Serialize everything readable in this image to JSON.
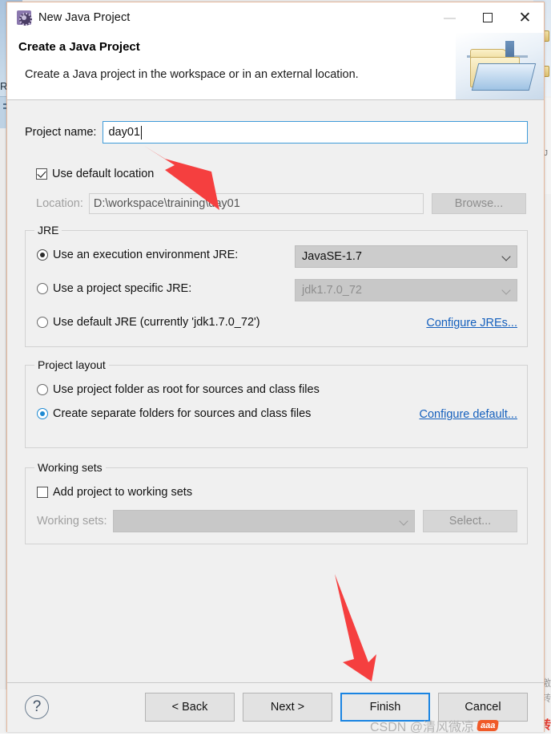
{
  "window": {
    "title": "New Java Project",
    "icon": "java-project-icon",
    "controls": {
      "minimize": "—",
      "maximize": "maximize-icon",
      "close": "×"
    }
  },
  "header": {
    "title": "Create a Java Project",
    "description": "Create a Java project in the workspace or in an external location.",
    "banner_icon": "java-project-folder-icon"
  },
  "form": {
    "project_name_label": "Project name:",
    "project_name_value": "day01",
    "use_default_location_label": "Use default location",
    "use_default_location_checked": true,
    "location_label": "Location:",
    "location_value": "D:\\workspace\\training\\day01",
    "browse_label": "Browse..."
  },
  "jre": {
    "group_title": "JRE",
    "option_execution_env": "Use an execution environment JRE:",
    "execution_env_value": "JavaSE-1.7",
    "option_project_specific": "Use a project specific JRE:",
    "project_specific_value": "jdk1.7.0_72",
    "option_default_jre": "Use default JRE (currently 'jdk1.7.0_72')",
    "configure_link": "Configure JREs...",
    "selected": "execution_env"
  },
  "project_layout": {
    "group_title": "Project layout",
    "option_project_folder": "Use project folder as root for sources and class files",
    "option_separate_folders": "Create separate folders for sources and class files",
    "configure_link": "Configure default...",
    "selected": "separate_folders"
  },
  "working_sets": {
    "group_title": "Working sets",
    "add_checkbox_label": "Add project to working sets",
    "add_checkbox_checked": false,
    "working_sets_label": "Working sets:",
    "working_sets_value": "",
    "select_label": "Select..."
  },
  "footer": {
    "help_label": "?",
    "back_label": "< Back",
    "next_label": "Next >",
    "finish_label": "Finish",
    "cancel_label": "Cancel",
    "default_button": "Finish"
  },
  "annotations": {
    "arrow_1_target": "project-name-input",
    "arrow_2_target": "finish-button",
    "arrow_color": "#f53f3f"
  },
  "watermark": {
    "text": "CSDN @清风微凉",
    "badge": "aaa"
  },
  "background": {
    "left_letter": "R",
    "right_glyph": "J",
    "right_text_top": "激",
    "right_text_bottom": "转",
    "right_red": "转"
  }
}
